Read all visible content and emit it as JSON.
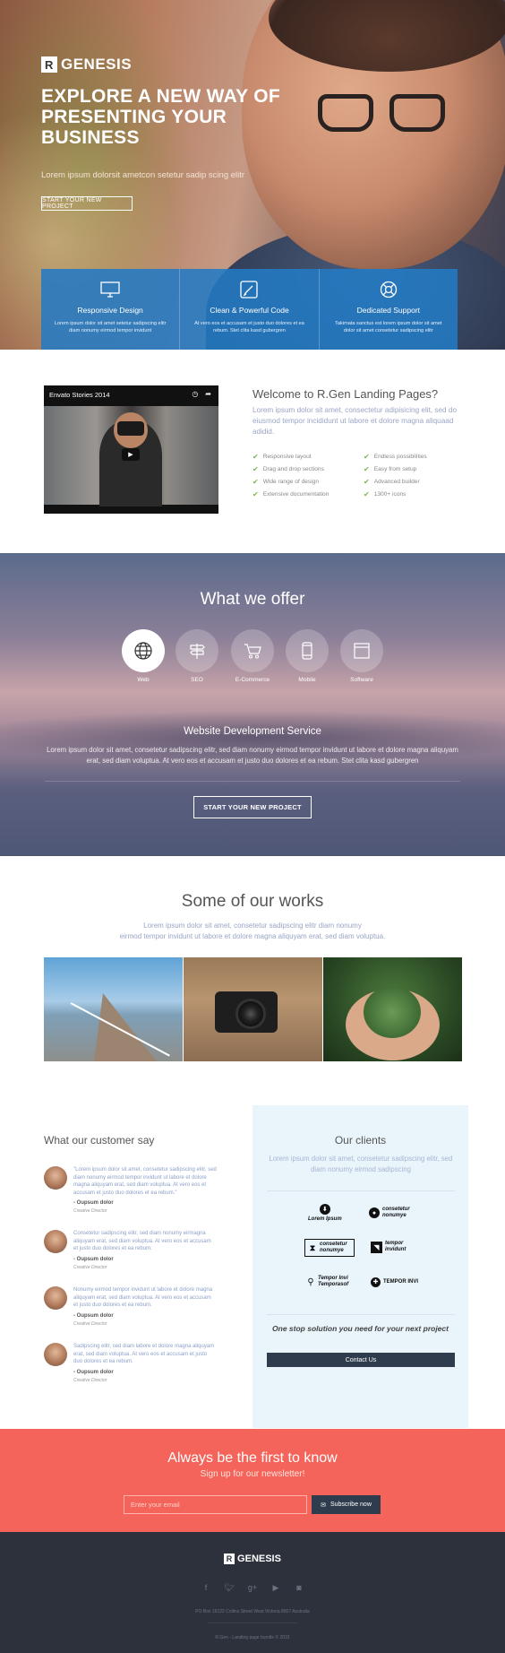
{
  "hero": {
    "logo_mark": "R",
    "logo_text": "GENESIS",
    "headline": "EXPLORE A NEW WAY OF PRESENTING YOUR BUSINESS",
    "subtitle": "Lorem ipsum dolorsit ametcon setetur sadip scing elitr",
    "cta": "START YOUR NEW PROJECT",
    "accent": "#237ac4"
  },
  "features": [
    {
      "icon": "monitor-icon",
      "title": "Responsive Design",
      "text": "Lorem ipsum dolor sit amet setetur sadipscing elitr diam nonumy eirmod tempor invidunt"
    },
    {
      "icon": "pen-icon",
      "title": "Clean & Powerful Code",
      "text": "At vero eos et accusam et justo duo dolores et ea rebum. Stet clita kasd gubergren"
    },
    {
      "icon": "lifebuoy-icon",
      "title": "Dedicated Support",
      "text": "Takimata sanctus est lorem ipsum dolor sit amet dolor sit amet consetetur sadipscing elitr"
    }
  ],
  "welcome": {
    "video_title": "Envato Stories 2014",
    "title": "Welcome to R.Gen Landing Pages?",
    "lead": "Lorem ipsum dolor sit amet, consectetur adipisicing elit, sed do eiusmod tempor incididunt ut labore et dolore magna aliquaad adidid.",
    "checklist": [
      "Responsive layout",
      "Endless possibilities",
      "Drag and drop sections",
      "Easy from setup",
      "Wide range of design",
      "Advanced builder",
      "Extensive documentation",
      "1300+ icons"
    ],
    "check_color": "#77b84e"
  },
  "offer": {
    "title": "What we offer",
    "services": [
      {
        "label": "Web",
        "icon": "globe-icon",
        "active": true
      },
      {
        "label": "SEO",
        "icon": "signpost-icon",
        "active": false
      },
      {
        "label": "E-Commerce",
        "icon": "cart-icon",
        "active": false
      },
      {
        "label": "Mobile",
        "icon": "mobile-icon",
        "active": false
      },
      {
        "label": "Software",
        "icon": "window-icon",
        "active": false
      }
    ],
    "service_title": "Website Development Service",
    "service_text": "Lorem ipsum dolor sit amet, consetetur sadipscing elitr, sed diam nonumy eirmod tempor invidunt ut labore et dolore magna aliquyam erat, sed diam voluptua. At vero eos et accusam et justo duo dolores et ea rebum. Stet clita kasd gubergren",
    "cta": "START YOUR NEW PROJECT"
  },
  "works": {
    "title": "Some of our works",
    "lead_1": "Lorem ipsum dolor sit amet, consetetur sadipscing elitr diam nonumy",
    "lead_2": "eirmod tempor invidunt ut labore et dolore magna aliquyam erat, sed diam voluptua."
  },
  "customers": {
    "title": "What our customer say",
    "testimonials": [
      {
        "quote": "\"Lorem ipsum dolor sit amet, consetetur sadipscing elitr, sed diam nonumy eirmod tempor invidunt ut labore et dolore magna aliquyam erat, sed diam voluptua. At vero eos et accusam et justo duo dolores et ea rebum.\"",
        "name": "- Oupsum dolor",
        "role": "Creative Director"
      },
      {
        "quote": "Consetetur sadipscing elitr, sed diam nonumy eirmagna aliquyam erat, sed diam voluptua. At vero eos et accusam et justo duo dolores et ea rebum.",
        "name": "- Oupsum dolor",
        "role": "Creative Director"
      },
      {
        "quote": "Nonumy eirmod tempor invidunt ut labore et dolore magna aliquyam erat, sed diam voluptua. At vero eos et accusam et justo duo dolores et ea rebum.",
        "name": "- Oupsum dolor",
        "role": "Creative Director"
      },
      {
        "quote": "Sadipscing elitr, sed diam labore et dolore magna aliquyam erat, sed diam voluptua. At vero eos et accusam et justo duo dolores et ea rebum.",
        "name": "- Oupsum dolor",
        "role": "Creative Director"
      }
    ]
  },
  "clients": {
    "title": "Our clients",
    "lead": "Lorem ipsum dolor sit amet, consetetur sadipscing elitr, sed diam nonumy eirmod sadipscing",
    "logos": {
      "lorem": "Lorem Ipsum",
      "consetetur_1": "consetetur nonumye",
      "consetetur_2": "consetetur nonumye",
      "tempor_1": "tempor invidunt",
      "tempor_2": "Tempor Invi Temporasof",
      "tempor_3": "TEMPOR INVI"
    },
    "tagline": "One stop solution you need for your next project",
    "cta": "Contact Us"
  },
  "newsletter": {
    "title": "Always be the first to know",
    "subtitle": "Sign up for our newsletter!",
    "placeholder": "Enter your email",
    "button": "Subscribe now",
    "background": "#f4645a"
  },
  "footer": {
    "logo_mark": "R",
    "logo_text": "GENESIS",
    "social": [
      "facebook-icon",
      "twitter-icon",
      "google-plus-icon",
      "youtube-icon",
      "instagram-icon"
    ],
    "address": "PO Box 16122 Collins Street West Victoria 8007 Australia",
    "copyright": "R.Gen - Landing page bundle © 2015",
    "background": "#2c313c"
  }
}
